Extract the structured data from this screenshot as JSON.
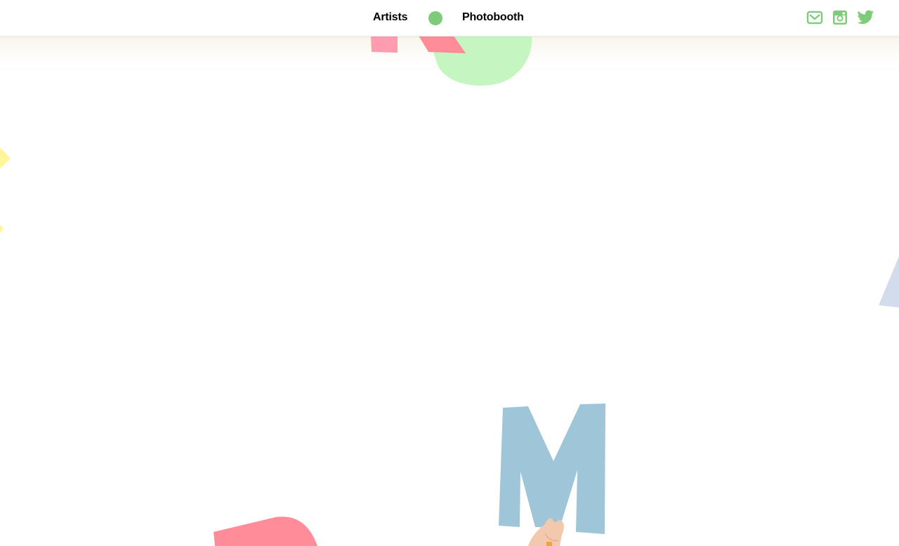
{
  "nav": {
    "artists_label": "Artists",
    "photobooth_label": "Photobooth",
    "logo_icon": "green-dot-logo-icon"
  },
  "social": {
    "icons": [
      "mail-icon",
      "instagram-icon",
      "twitter-icon"
    ]
  },
  "colors": {
    "accent": "#7ecb7a",
    "nav_text": "#000000",
    "pink": "#ff8fa0",
    "mint": "#c5f5c0",
    "blue_letter": "#9ec6d8",
    "yellow": "#fff59a",
    "lavender": "#d3dcec"
  }
}
